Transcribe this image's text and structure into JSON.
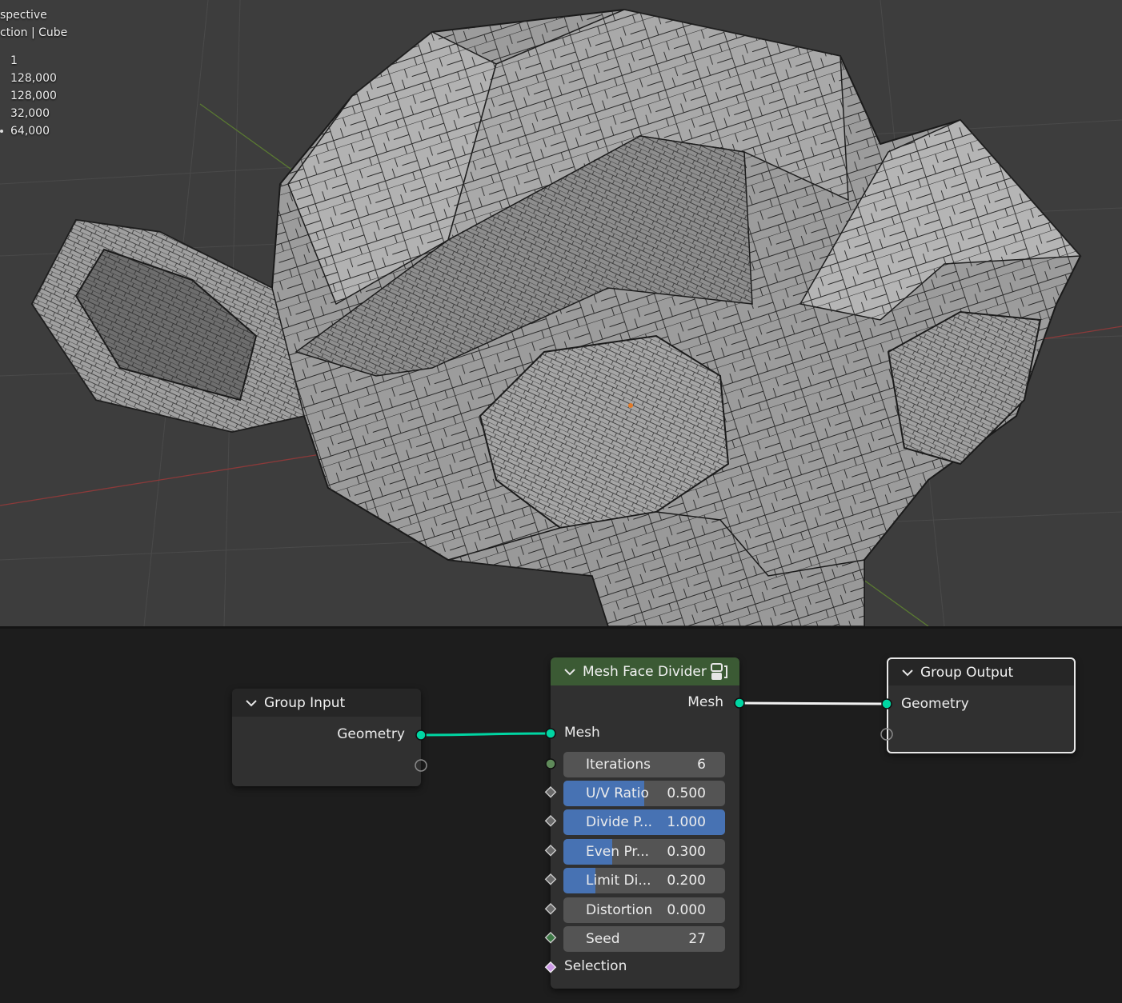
{
  "viewport": {
    "overlay_lines": [
      "spective",
      "ction | Cube"
    ],
    "stats": [
      "1",
      "128,000",
      "128,000",
      "32,000",
      "64,000"
    ]
  },
  "nodes": {
    "group_input": {
      "title": "Group Input",
      "outputs": [
        "Geometry"
      ]
    },
    "mesh_face_divider": {
      "title": "Mesh Face Divider",
      "output": "Mesh",
      "input": "Mesh",
      "fields": [
        {
          "name": "Iterations",
          "value": "6",
          "fill": 0
        },
        {
          "name": "U/V Ratio",
          "value": "0.500",
          "fill": 0.5
        },
        {
          "name": "Divide P...",
          "value": "1.000",
          "fill": 1.0
        },
        {
          "name": "Even Pr...",
          "value": "0.300",
          "fill": 0.3
        },
        {
          "name": "Limit Di...",
          "value": "0.200",
          "fill": 0.2
        },
        {
          "name": "Distortion",
          "value": "0.000",
          "fill": 0
        },
        {
          "name": "Seed",
          "value": "27",
          "fill": 0
        }
      ],
      "selection_label": "Selection"
    },
    "group_output": {
      "title": "Group Output",
      "inputs": [
        "Geometry"
      ]
    }
  },
  "colors": {
    "geometry_socket": "#00d6a3",
    "mesh_node_header": "#3b5a34",
    "field_fill": "#4772b3",
    "selection_socket": "#cc99e6",
    "int_socket": "#5f8a5a"
  }
}
